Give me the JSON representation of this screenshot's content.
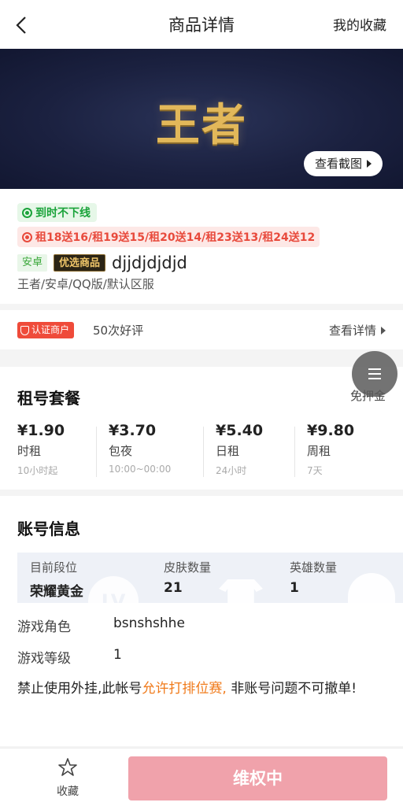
{
  "header": {
    "title": "商品详情",
    "favorites_link": "我的收藏",
    "back_icon": "chevron-left-icon"
  },
  "banner": {
    "game_title": "王者",
    "screenshot_button": "查看截图"
  },
  "info": {
    "tag_online": "到时不下线",
    "tag_promo": "租18送16/租19送15/租20送14/租23送13/租24送12",
    "tag_os": "安卓",
    "tag_premium": "优选商品",
    "account_name": "djjdjdjdjd",
    "account_sub": "王者/安卓/QQ版/默认区服"
  },
  "merchant": {
    "badge": "认证商户",
    "reviews": "50次好评",
    "detail_link": "查看详情"
  },
  "plans": {
    "title": "租号套餐",
    "no_deposit": "免押金",
    "items": [
      {
        "price": "¥1.90",
        "name": "时租",
        "note": "10小时起"
      },
      {
        "price": "¥3.70",
        "name": "包夜",
        "note": "10:00~00:00"
      },
      {
        "price": "¥5.40",
        "name": "日租",
        "note": "24小时"
      },
      {
        "price": "¥9.80",
        "name": "周租",
        "note": "7天"
      }
    ]
  },
  "account": {
    "title": "账号信息",
    "stats": [
      {
        "label": "目前段位",
        "value": "荣耀黄金"
      },
      {
        "label": "皮肤数量",
        "value": "21"
      },
      {
        "label": "英雄数量",
        "value": "1"
      }
    ],
    "watermark_lv": "LV",
    "role_label": "游戏角色",
    "role_value": "bsnshshhe",
    "level_label": "游戏等级",
    "level_value": "1",
    "notice_prefix": "禁止使用外挂,此帐号",
    "notice_highlight": "允许打排位赛,",
    "notice_suffix": " 非账号问题不可撤单!"
  },
  "bottom": {
    "collect_label": "收藏",
    "rights_button": "维权中"
  },
  "colors": {
    "accent_red": "#ef4b3a",
    "green": "#1aa33a",
    "highlight_orange": "#f07a1a",
    "button_pink": "#f0a2ab"
  }
}
